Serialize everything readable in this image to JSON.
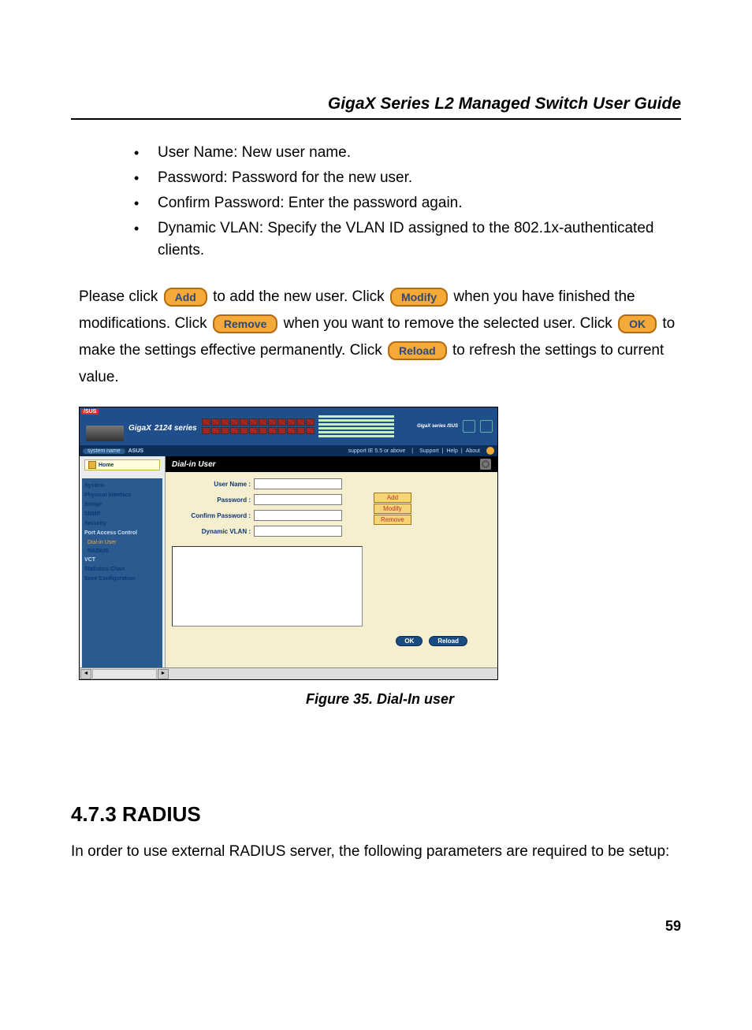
{
  "header_title": "GigaX Series L2 Managed Switch User Guide",
  "bullets": [
    "User Name: New user name.",
    "Password: Password for the new user.",
    "Confirm Password: Enter the password again.",
    "Dynamic VLAN: Specify the VLAN ID assigned to the 802.1x-authenticated clients."
  ],
  "instr": {
    "t1": "Please click ",
    "btn_add": "Add",
    "t2": "to add the new user. Click ",
    "btn_modify": "Modify",
    "t3": "when you have finished the modifications. Click ",
    "btn_remove": "Remove",
    "t4": "when you want to remove the selected user. Click ",
    "btn_ok": "OK",
    "t5": "to make the settings effective permanently. Click ",
    "btn_reload": "Reload",
    "t6": "to refresh the settings to current value."
  },
  "figure": {
    "asus_corner": "/SUS",
    "brand": "GigaX",
    "brand_series": "2124 series",
    "brand_small": "GigaX series /SUS",
    "sysbar": {
      "sysname_label": "system name",
      "sysname_value": "ASUS",
      "support": "support IE 5.5 or above",
      "links": [
        "Support",
        "Help",
        "About"
      ]
    },
    "home": "Home",
    "nav": [
      "System",
      "Physical Interface",
      "Bridge",
      "SNMP",
      "Security",
      "Port Access Control",
      "Dial-in User",
      "RADIUS",
      "VCT",
      "Statistics Chart",
      "Save Configuration"
    ],
    "panel_title": "Dial-in User",
    "form": {
      "user_name": "User Name :",
      "password": "Password :",
      "confirm": "Confirm Password :",
      "dvlan": "Dynamic VLAN :"
    },
    "mini_btns": {
      "add": "Add",
      "modify": "Modify",
      "remove": "Remove"
    },
    "bottom_btns": {
      "ok": "OK",
      "reload": "Reload"
    }
  },
  "figure_caption": "Figure 35.   Dial-In user",
  "section_heading": "4.7.3    RADIUS",
  "radius_para": "In order to use external RADIUS server, the following parameters are required to be setup:",
  "page_num": "59"
}
